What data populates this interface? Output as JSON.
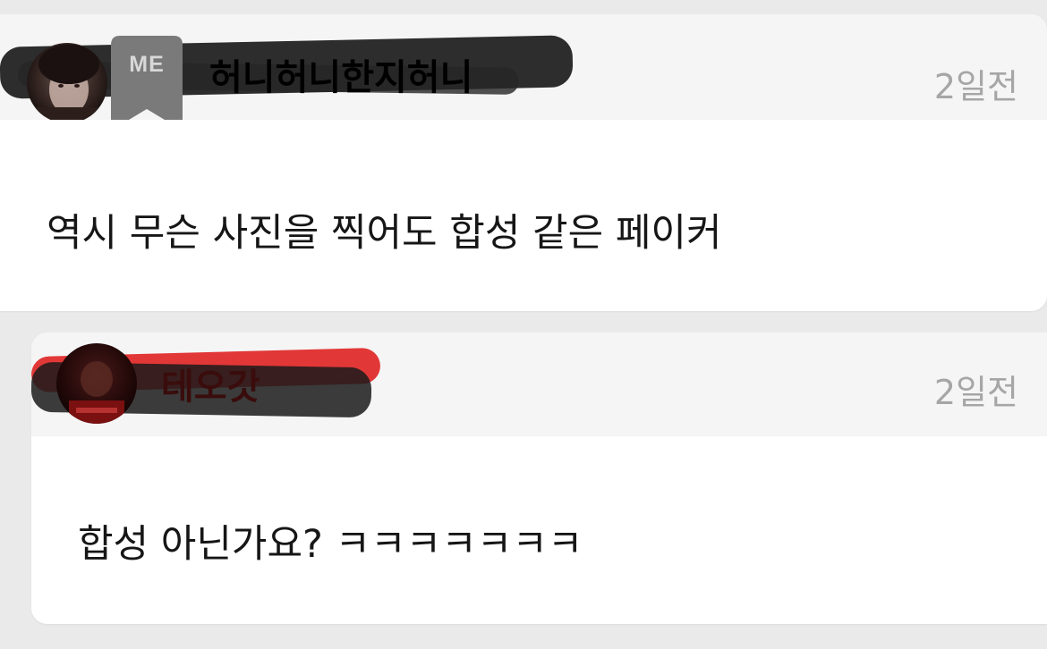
{
  "comments": [
    {
      "username": "허니허니한지허니",
      "badge": "ME",
      "time": "2일전",
      "text": "역시 무슨 사진을 찍어도 합성 같은 페이커"
    },
    {
      "username": "테오갓",
      "time": "2일전",
      "text": "합성 아닌가요? ㅋㅋㅋㅋㅋㅋㅋ"
    }
  ],
  "colors": {
    "page_background": "#eaeaea",
    "header_background": "#f5f5f5",
    "card_background": "#ffffff",
    "time_text": "#a6a6a6",
    "badge_background": "#7a7a7a",
    "scribble_dark": "#1c1c1c",
    "scribble_red": "#e02222"
  }
}
